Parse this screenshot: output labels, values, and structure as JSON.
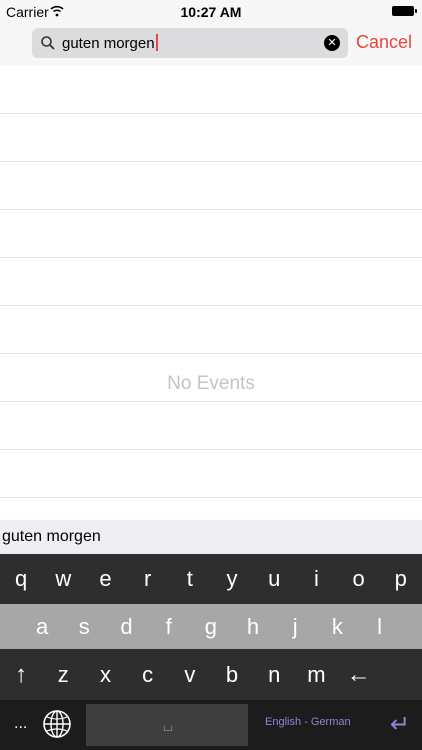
{
  "status_bar": {
    "carrier": "Carrier",
    "time": "10:27 AM"
  },
  "search": {
    "query": "guten morgen",
    "cancel_label": "Cancel"
  },
  "events": {
    "empty_label": "No Events"
  },
  "suggestion": {
    "text": "guten morgen"
  },
  "keyboard": {
    "row1": [
      "q",
      "w",
      "e",
      "r",
      "t",
      "y",
      "u",
      "i",
      "o",
      "p"
    ],
    "row2": [
      "a",
      "s",
      "d",
      "f",
      "g",
      "h",
      "j",
      "k",
      "l"
    ],
    "row3": [
      "z",
      "x",
      "c",
      "v",
      "b",
      "n",
      "m"
    ],
    "more_label": "...",
    "language_label": "English - German",
    "accent_color": "#8b87d6"
  }
}
